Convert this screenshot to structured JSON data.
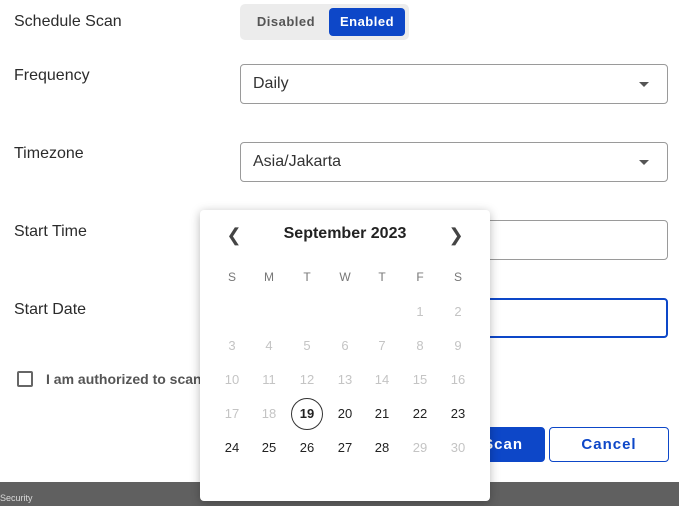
{
  "form": {
    "schedule_label": "Schedule Scan",
    "toggle": {
      "disabled": "Disabled",
      "enabled": "Enabled",
      "selected": "Enabled"
    },
    "frequency_label": "Frequency",
    "frequency_value": "Daily",
    "timezone_label": "Timezone",
    "timezone_value": "Asia/Jakarta",
    "start_time_label": "Start Time",
    "start_date_label": "Start Date",
    "authorized_text": "I am authorized to scan t",
    "scan_button_text": "Scan",
    "cancel_button_text": "Cancel"
  },
  "footer": {
    "text": "Security"
  },
  "calendar": {
    "month_title": "September 2023",
    "weekdays": [
      "S",
      "M",
      "T",
      "W",
      "T",
      "F",
      "S"
    ],
    "weeks": [
      [
        {
          "d": "",
          "s": "blank"
        },
        {
          "d": "",
          "s": "blank"
        },
        {
          "d": "",
          "s": "blank"
        },
        {
          "d": "",
          "s": "blank"
        },
        {
          "d": "",
          "s": "blank"
        },
        {
          "d": "1",
          "s": "dim"
        },
        {
          "d": "2",
          "s": "dim"
        }
      ],
      [
        {
          "d": "3",
          "s": "dim"
        },
        {
          "d": "4",
          "s": "dim"
        },
        {
          "d": "5",
          "s": "dim"
        },
        {
          "d": "6",
          "s": "dim"
        },
        {
          "d": "7",
          "s": "dim"
        },
        {
          "d": "8",
          "s": "dim"
        },
        {
          "d": "9",
          "s": "dim"
        }
      ],
      [
        {
          "d": "10",
          "s": "dim"
        },
        {
          "d": "11",
          "s": "dim"
        },
        {
          "d": "12",
          "s": "dim"
        },
        {
          "d": "13",
          "s": "dim"
        },
        {
          "d": "14",
          "s": "dim"
        },
        {
          "d": "15",
          "s": "dim"
        },
        {
          "d": "16",
          "s": "dim"
        }
      ],
      [
        {
          "d": "17",
          "s": "dim"
        },
        {
          "d": "18",
          "s": "dim"
        },
        {
          "d": "19",
          "s": "today"
        },
        {
          "d": "20",
          "s": "active"
        },
        {
          "d": "21",
          "s": "active"
        },
        {
          "d": "22",
          "s": "active"
        },
        {
          "d": "23",
          "s": "active"
        }
      ],
      [
        {
          "d": "24",
          "s": "active"
        },
        {
          "d": "25",
          "s": "active"
        },
        {
          "d": "26",
          "s": "active"
        },
        {
          "d": "27",
          "s": "active"
        },
        {
          "d": "28",
          "s": "active"
        },
        {
          "d": "29",
          "s": "dim"
        },
        {
          "d": "30",
          "s": "dim"
        }
      ]
    ]
  },
  "colors": {
    "accent": "#0d47c8",
    "footer": "#606060"
  }
}
